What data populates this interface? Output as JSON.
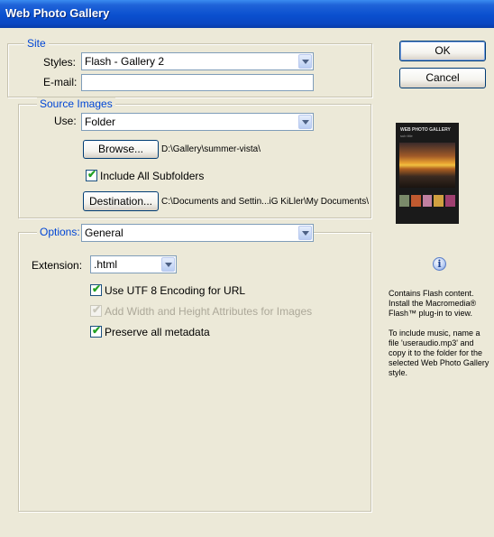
{
  "window": {
    "title": "Web Photo Gallery"
  },
  "site": {
    "legend": "Site",
    "styles_label": "Styles:",
    "styles_value": "Flash - Gallery 2",
    "email_label": "E-mail:",
    "email_value": ""
  },
  "source": {
    "legend": "Source Images",
    "use_label": "Use:",
    "use_value": "Folder",
    "browse_label": "Browse...",
    "browse_path": "D:\\Gallery\\summer-vista\\",
    "include_subfolders_label": "Include All Subfolders",
    "include_subfolders_checked": true,
    "destination_label": "Destination...",
    "destination_path": "C:\\Documents and Settin...iG KiLler\\My Documents\\"
  },
  "options": {
    "legend": "Options:",
    "section_value": "General",
    "extension_label": "Extension:",
    "extension_value": ".html",
    "utf8_label": "Use UTF 8 Encoding for URL",
    "utf8_checked": true,
    "width_height_label": "Add Width and Height Attributes for Images",
    "width_height_checked": true,
    "width_height_enabled": false,
    "preserve_label": "Preserve all metadata",
    "preserve_checked": true
  },
  "buttons": {
    "ok": "OK",
    "cancel": "Cancel"
  },
  "preview": {
    "title": "WEB PHOTO GALLERY",
    "subtitle": "sub title"
  },
  "info": {
    "icon": "info-icon",
    "text1": "Contains Flash content.\nInstall the Macromedia®\nFlash™ plug-in to view.",
    "text2": "To include music, name a\nfile 'useraudio.mp3' and\ncopy it to the folder for the\nselected Web Photo Gallery\nstyle."
  },
  "colors": {
    "titlebar": "#0a4fcf",
    "legend": "#0046d5",
    "check": "#21a121"
  }
}
